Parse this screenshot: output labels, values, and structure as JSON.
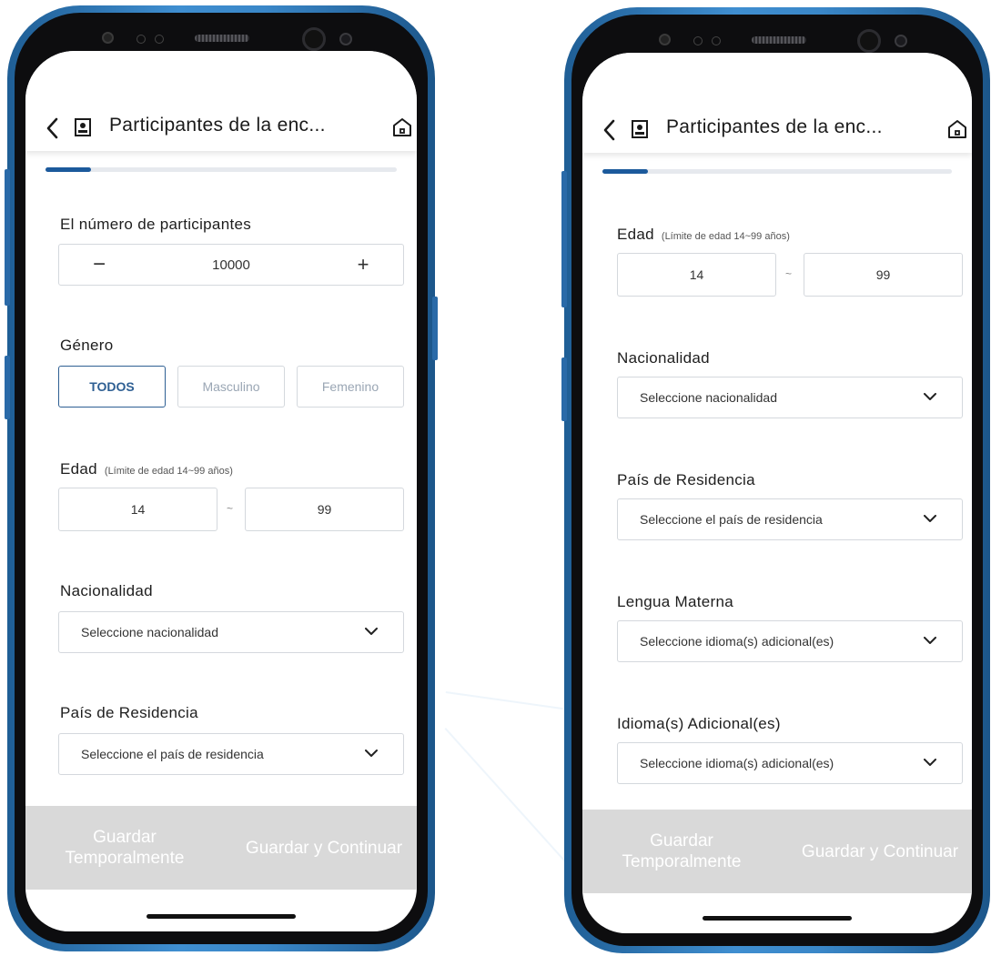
{
  "app": {
    "title": "Participantes de la enc...",
    "progress_fraction": 0.13
  },
  "labels": {
    "participants": "El número de participantes",
    "gender": "Género",
    "age": "Edad",
    "age_hint": "(Límite de edad 14~99 años)",
    "nationality": "Nacionalidad",
    "residence": "País de Residencia",
    "mother_tongue": "Lengua Materna",
    "additional_languages": "Idioma(s) Adicional(es)"
  },
  "participants": {
    "value": "10000",
    "minus": "−",
    "plus": "+"
  },
  "gender_options": [
    "TODOS",
    "Masculino",
    "Femenino"
  ],
  "age": {
    "min": "14",
    "separator": "~",
    "max": "99"
  },
  "placeholders": {
    "nationality": "Seleccione nacionalidad",
    "residence": "Seleccione el país de residencia",
    "mother_tongue": "Seleccione idioma(s) adicional(es)",
    "additional_languages": "Seleccione idioma(s) adicional(es)"
  },
  "buttons": {
    "save_temp_line1": "Guardar",
    "save_temp_line2": "Temporalmente",
    "save_continue": "Guardar y Continuar"
  },
  "icons": {
    "back": "chevron-left-icon",
    "doc": "contact-document-icon",
    "home": "home-icon",
    "dropdown": "chevron-down-icon"
  },
  "colors": {
    "accent": "#2e5f93",
    "progress": "#1c5a9c",
    "phone_frame": "#3a87c8",
    "bottom_bar": "#d9d9d9"
  }
}
